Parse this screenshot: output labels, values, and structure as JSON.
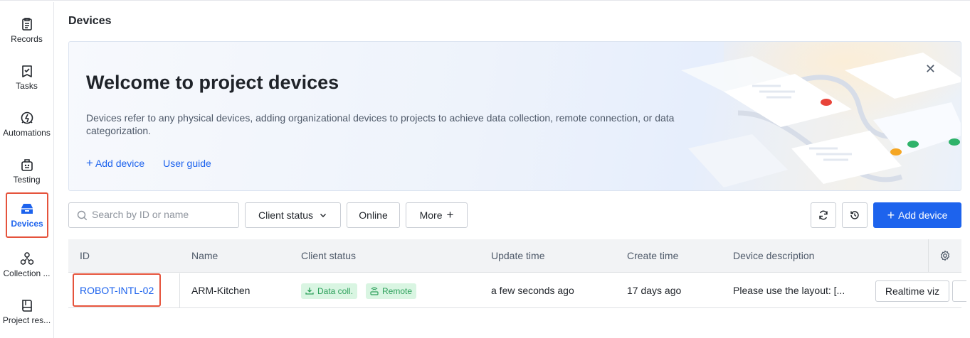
{
  "sidebar": {
    "items": [
      {
        "label": "Records",
        "icon": "records-icon",
        "active": false
      },
      {
        "label": "Tasks",
        "icon": "tasks-icon",
        "active": false
      },
      {
        "label": "Automations",
        "icon": "automations-icon",
        "active": false
      },
      {
        "label": "Testing",
        "icon": "testing-icon",
        "active": false
      },
      {
        "label": "Devices",
        "icon": "devices-icon",
        "active": true
      },
      {
        "label": "Collection ...",
        "icon": "collection-icon",
        "active": false
      },
      {
        "label": "Project res...",
        "icon": "project-resources-icon",
        "active": false
      }
    ]
  },
  "header": {
    "title": "Devices"
  },
  "banner": {
    "title": "Welcome to project devices",
    "description": "Devices refer to any physical devices, adding organizational devices to projects to achieve data collection, remote connection, or data categorization.",
    "add_device_link": "Add device",
    "user_guide_link": "User guide",
    "close_icon": "close-icon"
  },
  "toolbar": {
    "search_placeholder": "Search by ID or name",
    "client_status_label": "Client status",
    "online_label": "Online",
    "more_label": "More",
    "add_device_label": "Add device"
  },
  "table": {
    "columns": [
      "ID",
      "Name",
      "Client status",
      "Update time",
      "Create time",
      "Device description"
    ],
    "rows": [
      {
        "id": "ROBOT-INTL-02",
        "name": "ARM-Kitchen",
        "status_tags": [
          "Data coll.",
          "Remote"
        ],
        "update_time": "a few seconds ago",
        "create_time": "17 days ago",
        "description": "Please use the layout: [...",
        "action_label": "Realtime viz"
      }
    ]
  },
  "colors": {
    "accent": "#1d63ed",
    "highlight": "#e5533c",
    "tag_bg": "#d9f5e2",
    "tag_text": "#2ea15c"
  }
}
